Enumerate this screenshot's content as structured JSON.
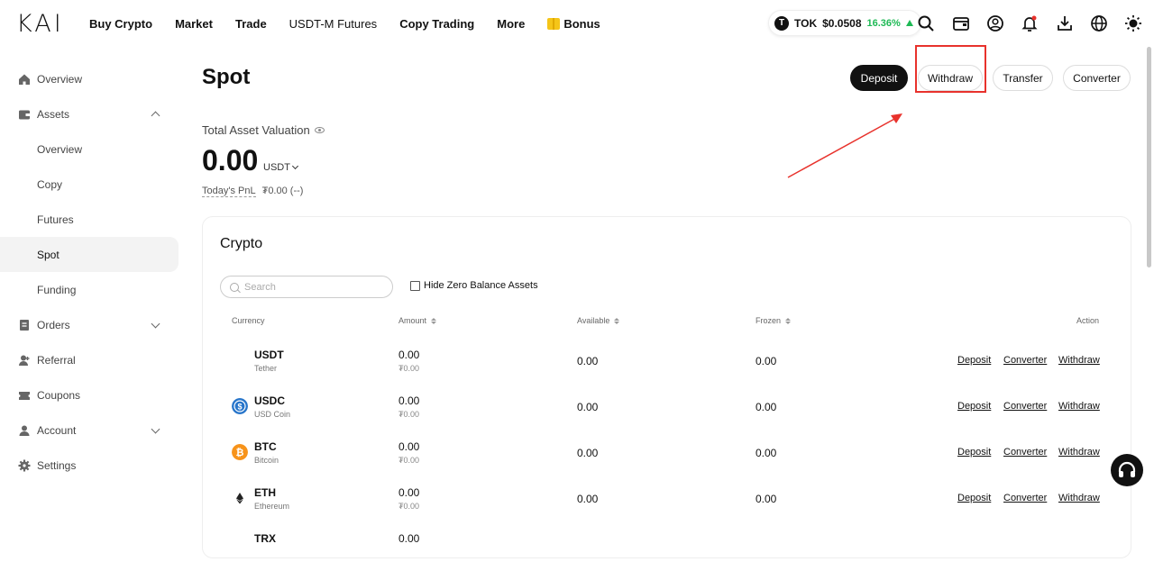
{
  "brand": {
    "logo": "KAI"
  },
  "nav": {
    "items": [
      "Buy Crypto",
      "Market",
      "Trade",
      "USDT-M Futures",
      "Copy Trading",
      "More"
    ],
    "bonus": "Bonus"
  },
  "ticker": {
    "symbol": "TOK",
    "price": "$0.0508",
    "change": "16.36%",
    "icon_letter": "T"
  },
  "sidebar": {
    "overview": "Overview",
    "assets": "Assets",
    "assets_sub": [
      "Overview",
      "Copy",
      "Futures",
      "Spot",
      "Funding"
    ],
    "orders": "Orders",
    "referral": "Referral",
    "coupons": "Coupons",
    "account": "Account",
    "settings": "Settings"
  },
  "page": {
    "title": "Spot",
    "buttons": {
      "deposit": "Deposit",
      "withdraw": "Withdraw",
      "transfer": "Transfer",
      "converter": "Converter"
    },
    "valuation_label": "Total Asset Valuation",
    "balance": "0.00",
    "balance_unit": "USDT",
    "pnl_label": "Today's PnL",
    "pnl_value": "₮0.00 (--)"
  },
  "crypto": {
    "title": "Crypto",
    "search_placeholder": "Search",
    "hide_zero": "Hide Zero Balance Assets",
    "headers": {
      "currency": "Currency",
      "amount": "Amount",
      "available": "Available",
      "frozen": "Frozen",
      "action": "Action"
    },
    "actions": {
      "deposit": "Deposit",
      "converter": "Converter",
      "withdraw": "Withdraw"
    },
    "rows": [
      {
        "symbol": "USDT",
        "name": "Tether",
        "amount": "0.00",
        "amount_sub": "₮0.00",
        "available": "0.00",
        "frozen": "0.00",
        "icon": "tether-icon",
        "color": ""
      },
      {
        "symbol": "USDC",
        "name": "USD Coin",
        "amount": "0.00",
        "amount_sub": "₮0.00",
        "available": "0.00",
        "frozen": "0.00",
        "icon": "usdc-icon",
        "color": "#2775ca"
      },
      {
        "symbol": "BTC",
        "name": "Bitcoin",
        "amount": "0.00",
        "amount_sub": "₮0.00",
        "available": "0.00",
        "frozen": "0.00",
        "icon": "bitcoin-icon",
        "color": "#f7931a"
      },
      {
        "symbol": "ETH",
        "name": "Ethereum",
        "amount": "0.00",
        "amount_sub": "₮0.00",
        "available": "0.00",
        "frozen": "0.00",
        "icon": "ethereum-icon",
        "color": "#222"
      },
      {
        "symbol": "TRX",
        "name": "",
        "amount": "0.00",
        "amount_sub": "",
        "available": "",
        "frozen": "",
        "icon": "tron-icon",
        "color": ""
      }
    ]
  }
}
